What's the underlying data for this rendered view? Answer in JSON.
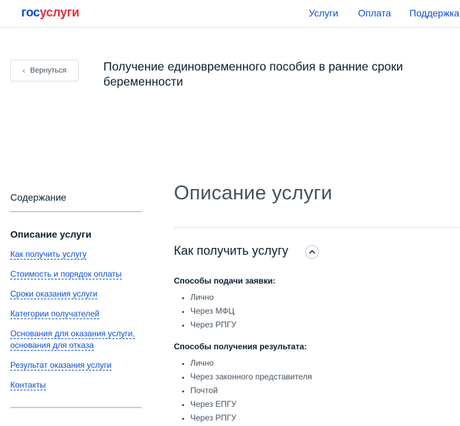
{
  "logo": {
    "part1": "гос",
    "part2": "услуги"
  },
  "nav": {
    "services": "Услуги",
    "payment": "Оплата",
    "support": "Поддержка"
  },
  "back_button": {
    "label": "Вернуться"
  },
  "service": {
    "title": "Получение единовременного пособия в ранние сроки беременности"
  },
  "toc": {
    "title": "Содержание",
    "current": "Описание услуги",
    "links": [
      "Как получить услугу",
      "Стоимость и порядок оплаты",
      "Сроки оказания услуги",
      "Категории получателей",
      "Основания для оказания услуги, основания для отказа",
      "Результат оказания услуги",
      "Контакты"
    ]
  },
  "main": {
    "title": "Описание услуги",
    "section_title": "Как получить услугу",
    "submission": {
      "title": "Способы подачи заявки:",
      "items": [
        "Лично",
        "Через МФЦ",
        "Через РПГУ"
      ]
    },
    "result": {
      "title": "Способы получения результата:",
      "items": [
        "Лично",
        "Через законного представителя",
        "Почтой",
        "Через ЕПГУ",
        "Через РПГУ"
      ]
    }
  }
}
